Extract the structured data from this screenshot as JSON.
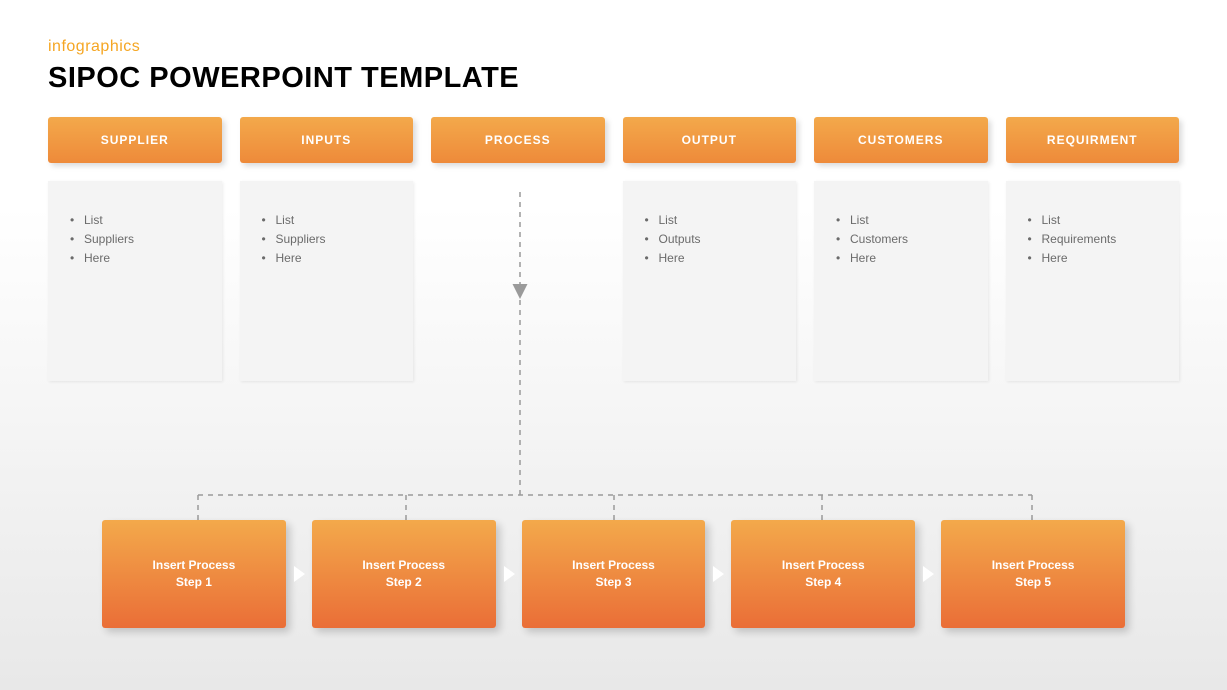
{
  "header": {
    "subtitle": "infographics",
    "title": "SIPOC POWERPOINT TEMPLATE"
  },
  "columns": [
    {
      "label": "SUPPLIER",
      "items": [
        "List",
        "Suppliers",
        "Here"
      ]
    },
    {
      "label": "INPUTS",
      "items": [
        "List",
        "Suppliers",
        "Here"
      ]
    },
    {
      "label": "PROCESS",
      "items": []
    },
    {
      "label": "OUTPUT",
      "items": [
        "List",
        "Outputs",
        "Here"
      ]
    },
    {
      "label": "CUSTOMERS",
      "items": [
        "List",
        "Customers",
        "Here"
      ]
    },
    {
      "label": "REQUIRMENT",
      "items": [
        "List",
        "Requirements",
        "Here"
      ]
    }
  ],
  "steps": [
    {
      "line1": "Insert Process",
      "line2": "Step 1"
    },
    {
      "line1": "Insert Process",
      "line2": "Step 2"
    },
    {
      "line1": "Insert Process",
      "line2": "Step 3"
    },
    {
      "line1": "Insert Process",
      "line2": "Step 4"
    },
    {
      "line1": "Insert Process",
      "line2": "Step 5"
    }
  ]
}
